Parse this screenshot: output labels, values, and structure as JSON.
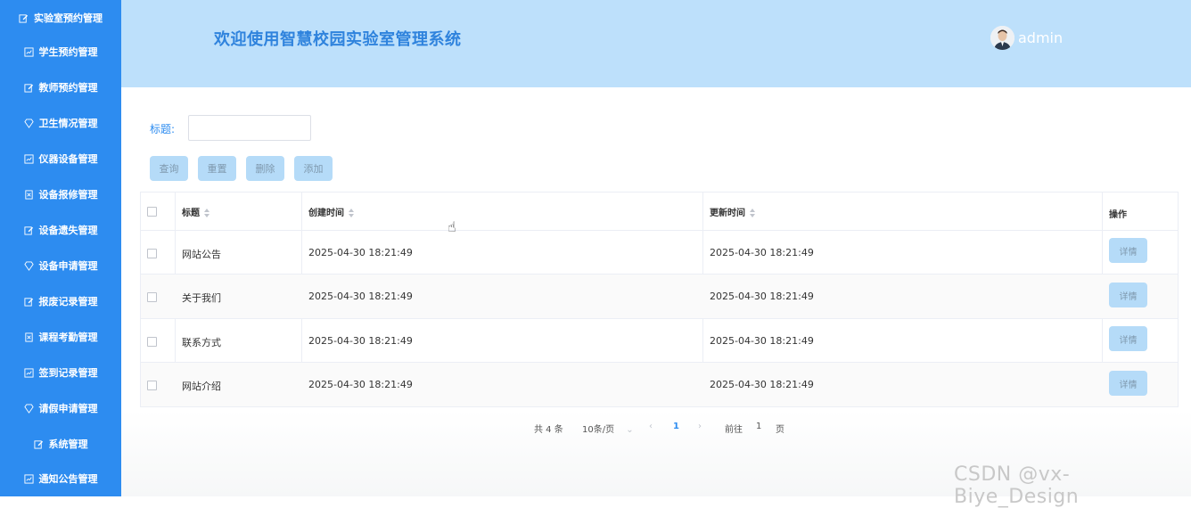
{
  "sidebar": {
    "items": [
      {
        "label": "实验室预约管理",
        "icon": "edit-icon"
      },
      {
        "label": "学生预约管理",
        "icon": "chart-icon"
      },
      {
        "label": "教师预约管理",
        "icon": "edit-icon"
      },
      {
        "label": "卫生情况管理",
        "icon": "gem-icon"
      },
      {
        "label": "仪器设备管理",
        "icon": "chart-icon"
      },
      {
        "label": "设备报修管理",
        "icon": "doc-icon"
      },
      {
        "label": "设备遗失管理",
        "icon": "edit-icon"
      },
      {
        "label": "设备申请管理",
        "icon": "gem-icon"
      },
      {
        "label": "报废记录管理",
        "icon": "edit-icon"
      },
      {
        "label": "课程考勤管理",
        "icon": "doc-icon"
      },
      {
        "label": "签到记录管理",
        "icon": "chart-icon"
      },
      {
        "label": "请假申请管理",
        "icon": "gem-icon"
      },
      {
        "label": "系统管理",
        "icon": "edit-icon"
      },
      {
        "label": "通知公告管理",
        "icon": "chart-icon"
      }
    ]
  },
  "header": {
    "title": "欢迎使用智慧校园实验室管理系统",
    "username": "admin"
  },
  "search": {
    "label": "标题:",
    "value": "",
    "placeholder": ""
  },
  "toolbar": {
    "query": "查询",
    "reset": "重置",
    "delete": "删除",
    "add": "添加"
  },
  "table": {
    "columns": [
      "标题",
      "创建时间",
      "更新时间",
      "操作"
    ],
    "rows": [
      {
        "title": "网站公告",
        "created": "2025-04-30 18:21:49",
        "updated": "2025-04-30 18:21:49",
        "action": "详情"
      },
      {
        "title": "关于我们",
        "created": "2025-04-30 18:21:49",
        "updated": "2025-04-30 18:21:49",
        "action": "详情"
      },
      {
        "title": "联系方式",
        "created": "2025-04-30 18:21:49",
        "updated": "2025-04-30 18:21:49",
        "action": "详情"
      },
      {
        "title": "网站介绍",
        "created": "2025-04-30 18:21:49",
        "updated": "2025-04-30 18:21:49",
        "action": "详情"
      }
    ]
  },
  "pagination": {
    "total": "共 4 条",
    "page_size": "10条/页",
    "current_page": "1",
    "goto_prefix": "前往",
    "goto_value": "1",
    "goto_suffix": "页"
  },
  "watermark": "CSDN @vx-Biye_Design",
  "colors": {
    "sidebar": "#2d8cf0",
    "header": "#bde0fb",
    "title": "#2f83dd",
    "button": "#b5dbf8"
  }
}
